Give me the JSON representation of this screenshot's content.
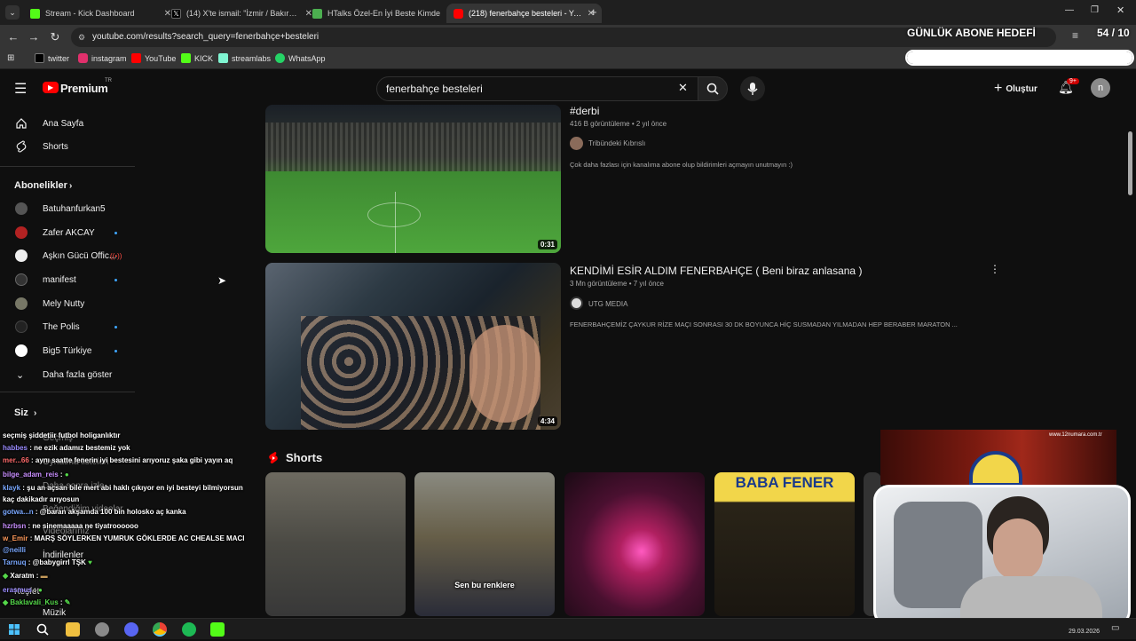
{
  "browser": {
    "tabs": [
      {
        "title": "Stream - Kick Dashboard",
        "color": "#53fc18",
        "active": false
      },
      {
        "title": "(14) X'te ismail: \"İzmir / Bakırçay",
        "color": "#000000",
        "active": false
      },
      {
        "title": "HTalks Özel-En İyi Beste Kimde",
        "color": "#4caf50",
        "active": false
      },
      {
        "title": "(218) fenerbahçe besteleri - YouTube",
        "color": "#ff0000",
        "active": true
      }
    ],
    "new_tab_label": "+",
    "url": "youtube.com/results?search_query=fenerbahçe+besteleri",
    "bookmarks": [
      {
        "label": "twitter",
        "color": "#000000"
      },
      {
        "label": "instagram",
        "color": "#e1306c"
      },
      {
        "label": "YouTube",
        "color": "#ff0000"
      },
      {
        "label": "KICK",
        "color": "#53fc18"
      },
      {
        "label": "streamlabs",
        "color": "#80f5d2"
      },
      {
        "label": "WhatsApp",
        "color": "#25d366"
      }
    ]
  },
  "youtube": {
    "logo_text": "Premium",
    "logo_sup": "TR",
    "search_value": "fenerbahçe besteleri",
    "create_label": "Oluştur",
    "notif_badge": "9+",
    "avatar_letter": "n"
  },
  "sidebar": {
    "home": "Ana Sayfa",
    "shorts": "Shorts",
    "subs_header": "Abonelikler",
    "subscriptions": [
      {
        "name": "Batuhanfurkan5",
        "color": "#555555",
        "dot": false
      },
      {
        "name": "Zafer AKCAY",
        "color": "#b22222",
        "dot": true
      },
      {
        "name": "Aşkın Gücü Offic...",
        "color": "#eeeeee",
        "dot": false,
        "live": true
      },
      {
        "name": "manifest",
        "color": "#333333",
        "dot": true
      },
      {
        "name": "Mely Nutty",
        "color": "#777766",
        "dot": false
      },
      {
        "name": "The Polis",
        "color": "#222222",
        "dot": true
      },
      {
        "name": "Big5 Türkiye",
        "color": "#ffffff",
        "dot": true
      }
    ],
    "show_more": "Daha fazla göster",
    "you_header": "Siz",
    "you_items": [
      "Geçmiş",
      "Oynatma listeleri",
      "Daha sonra izle",
      "Beğendiğim videolar",
      "Videolarınız",
      "İndirilenler"
    ],
    "explore_header": "Keşfet",
    "music": "Müzik"
  },
  "results": [
    {
      "title": "#derbi",
      "meta": "416 B görüntüleme • 2 yıl önce",
      "channel": "Tribündeki Kıbrıslı",
      "desc": "Çok daha fazlası için kanalıma abone olup bildirimleri açmayın unutmayın :)",
      "duration": "0:31"
    },
    {
      "title": "KENDİMİ ESİR ALDIM FENERBAHÇE ( Beni biraz anlasana )",
      "meta": "3 Mn görüntüleme • 7 yıl önce",
      "channel": "UTG MEDIA",
      "desc": "FENERBAHÇEMİZ ÇAYKUR RİZE MAÇI SONRASI 30 DK BOYUNCA HİÇ SUSMADAN YILMADAN HEP BERABER MARATON ...",
      "duration": "4:34"
    }
  ],
  "shorts_section": {
    "title": "Shorts",
    "items": [
      {
        "caption": ""
      },
      {
        "caption": "Sen bu renklere"
      },
      {
        "caption": ""
      },
      {
        "caption": "BABA FENER"
      }
    ]
  },
  "chat": [
    {
      "user": "",
      "text": "seçmiş şiddetiir futbol holiganlıktır"
    },
    {
      "user": "habbes",
      "text": "ne ezik adamız bestemiz yok"
    },
    {
      "user": "mer...66",
      "text": "aynı saatte fenerin iyi bestesini arıyoruz şaka gibi yayın aq"
    },
    {
      "user": "bilge_adam_reis",
      "text": ""
    },
    {
      "user": "klayk",
      "text": "şu an açsan bile mert abi haklı çıkıyor en iyi besteyi bilmiyorsun"
    },
    {
      "user": "",
      "text": "kaç dakikadır arıyosun"
    },
    {
      "user": "gotwa...n",
      "text": "@baran akşamda 100 bin holosko aç kanka"
    },
    {
      "user": "hzrbsn",
      "text": "ne sinemaaaaa ne tiyatroooooo"
    },
    {
      "user": "w_Emir",
      "text": "MARŞ SÖYLERKEN YUMRUK GÖKLERDE AC CHEALSE MACI"
    },
    {
      "user": "@neilli",
      "text": ""
    },
    {
      "user": "Tarnuq",
      "text": "@babygirrl TŞK"
    },
    {
      "user": "Xaratm",
      "text": ""
    },
    {
      "user": "erasmus",
      "text": ""
    },
    {
      "user": "Baklavali_Kus",
      "text": ""
    }
  ],
  "overlay": {
    "goal_title": "GÜNLÜK ABONE HEDEFİ",
    "goal_count": "54 / 10",
    "goal_progress": 1.0,
    "webcam_site": "www.12numara.com.tr"
  },
  "taskbar": {
    "date": "29.03.2026",
    "apps": [
      "start",
      "search",
      "explorer",
      "app-gray",
      "discord",
      "chrome",
      "spotify",
      "obs"
    ]
  }
}
